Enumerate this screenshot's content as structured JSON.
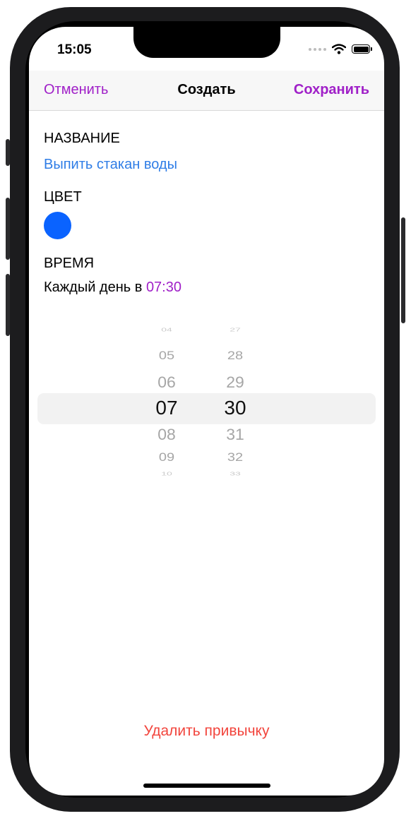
{
  "status_bar": {
    "time": "15:05",
    "icons": [
      "cellular-signal-icon",
      "wifi-icon",
      "battery-icon"
    ]
  },
  "nav": {
    "cancel": "Отменить",
    "title": "Создать",
    "save": "Сохранить"
  },
  "form": {
    "name_label": "НАЗВАНИЕ",
    "name_value": "Выпить стакан воды",
    "color_label": "ЦВЕТ",
    "color_value": "#0a63ff",
    "time_label": "ВРЕМЯ",
    "time_prefix": "Каждый день в",
    "time_value": "07:30"
  },
  "time_picker": {
    "hours": [
      "04",
      "05",
      "06",
      "07",
      "08",
      "09",
      "10"
    ],
    "minutes": [
      "27",
      "28",
      "29",
      "30",
      "31",
      "32",
      "33"
    ],
    "selected_hour": "07",
    "selected_minute": "30"
  },
  "delete_label": "Удалить привычку",
  "colors": {
    "accent": "#a020c8",
    "link": "#2f7de6",
    "destructive": "#f2453d"
  }
}
